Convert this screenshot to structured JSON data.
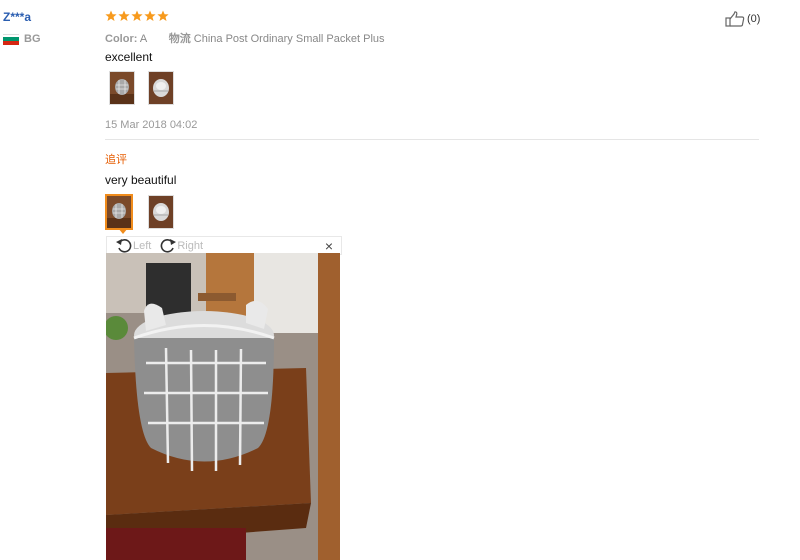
{
  "reviewer": {
    "name": "Z***a",
    "country": "BG"
  },
  "review": {
    "rating": 5,
    "color_label": "Color:",
    "color_value": "A",
    "shipping_label": "物流",
    "shipping_value": "China Post Ordinary Small Packet Plus",
    "helpful_count": "(0)",
    "text": "excellent",
    "date": "15 Mar 2018 04:02"
  },
  "followup": {
    "label": "追评",
    "text": "very beautiful"
  },
  "viewer": {
    "rotate_left": "Left",
    "rotate_right": "Right",
    "close": "×"
  },
  "icons": {
    "star": "star-icon",
    "thumbs_up": "thumbs-up-icon",
    "rotate_left": "rotate-left-icon",
    "rotate_right": "rotate-right-icon",
    "close": "close-icon"
  },
  "colors": {
    "username": "#2a5db0",
    "star": "#f79a1d",
    "followup": "#e65c00",
    "selected_border": "#f08c1c"
  }
}
